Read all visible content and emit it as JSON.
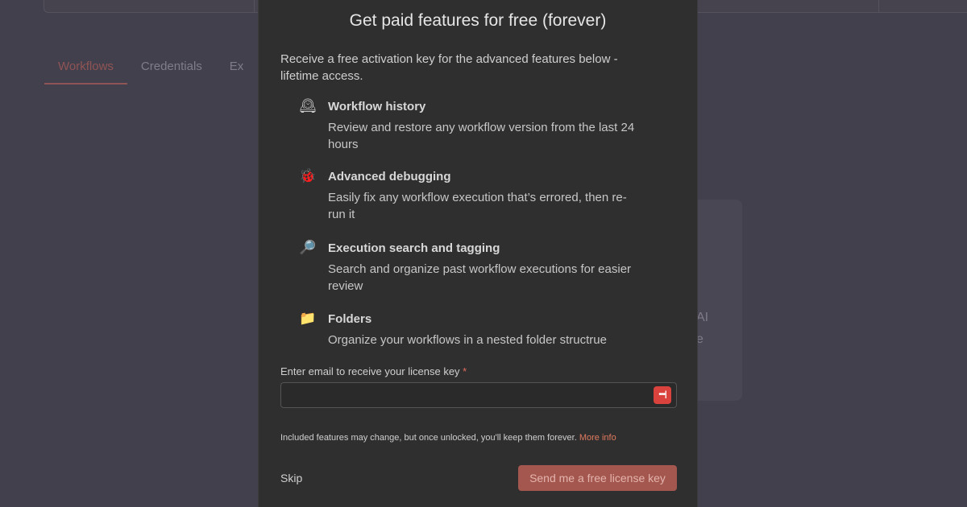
{
  "background": {
    "tabs": [
      {
        "label": "Workflows",
        "active": true
      },
      {
        "label": "Credentials",
        "active": false
      },
      {
        "label": "Ex",
        "active": false
      }
    ],
    "card_fragments": [
      "AI",
      "e"
    ]
  },
  "modal": {
    "title": "Get paid features for free (forever)",
    "intro": "Receive a free activation key for the advanced features below - lifetime access.",
    "features": [
      {
        "icon": "mantel-clock-icon",
        "glyph": "🕰",
        "title": "Workflow history",
        "description": "Review and restore any workflow version from the last 24 hours"
      },
      {
        "icon": "bug-icon",
        "glyph": "🐞",
        "title": "Advanced debugging",
        "description": "Easily fix any workflow execution that’s errored, then re-run it"
      },
      {
        "icon": "magnifier-icon",
        "glyph": "🔎",
        "title": "Execution search and tagging",
        "description": "Search and organize past workflow executions for easier review"
      },
      {
        "icon": "folder-icon",
        "glyph": "📁",
        "title": "Folders",
        "description": "Organize your workflows in a nested folder structrue"
      }
    ],
    "email": {
      "label": "Enter email to receive your license key",
      "required_marker": "*",
      "value": "",
      "placeholder": ""
    },
    "password_manager_icon": "•••|",
    "note": "Included features may change, but once unlocked, you'll keep them forever.",
    "more_info": "More info",
    "skip_label": "Skip",
    "send_label": "Send me a free license key"
  },
  "colors": {
    "backdrop": "#43404d",
    "modal_bg": "#2f2f2f",
    "accent": "#a4574e",
    "link": "#e07a5f",
    "required": "#e06b5e"
  }
}
